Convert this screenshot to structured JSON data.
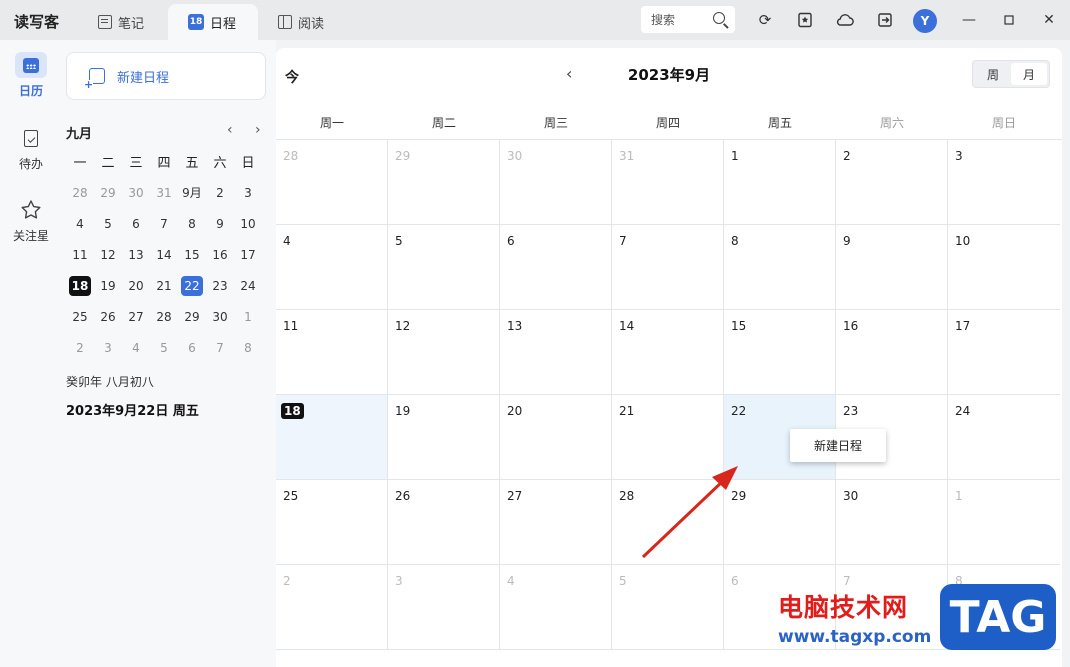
{
  "app": {
    "name": "读写客"
  },
  "tabs": [
    {
      "label": "笔记",
      "icon": "notes-icon"
    },
    {
      "label": "日程",
      "icon": "calendar-icon",
      "badge": "18",
      "active": true
    },
    {
      "label": "阅读",
      "icon": "reader-icon"
    }
  ],
  "toolbar": {
    "search_label": "搜索",
    "avatar_initial": "Y"
  },
  "rail": [
    {
      "label": "日历",
      "icon": "calendar-icon",
      "active": true
    },
    {
      "label": "待办",
      "icon": "clipboard-check-icon"
    },
    {
      "label": "关注星",
      "icon": "star-icon"
    }
  ],
  "side": {
    "new_event_label": "新建日程",
    "mini_month": "九月",
    "weekdays": [
      "一",
      "二",
      "三",
      "四",
      "五",
      "六",
      "日"
    ],
    "rows": [
      [
        "28",
        "29",
        "30",
        "31",
        "9月",
        "2",
        "3"
      ],
      [
        "4",
        "5",
        "6",
        "7",
        "8",
        "9",
        "10"
      ],
      [
        "11",
        "12",
        "13",
        "14",
        "15",
        "16",
        "17"
      ],
      [
        "18",
        "19",
        "20",
        "21",
        "22",
        "23",
        "24"
      ],
      [
        "25",
        "26",
        "27",
        "28",
        "29",
        "30",
        "1"
      ],
      [
        "2",
        "3",
        "4",
        "5",
        "6",
        "7",
        "8"
      ]
    ],
    "lunar": "癸卯年  八月初八",
    "selected_date": "2023年9月22日  周五"
  },
  "calendar": {
    "today_label": "今",
    "month_title": "2023年9月",
    "view_week": "周",
    "view_month": "月",
    "weekdays": [
      "周一",
      "周二",
      "周三",
      "周四",
      "周五",
      "周六",
      "周日"
    ],
    "weeks": [
      [
        "28",
        "29",
        "30",
        "31",
        "1",
        "2",
        "3"
      ],
      [
        "4",
        "5",
        "6",
        "7",
        "8",
        "9",
        "10"
      ],
      [
        "11",
        "12",
        "13",
        "14",
        "15",
        "16",
        "17"
      ],
      [
        "18",
        "19",
        "20",
        "21",
        "22",
        "23",
        "24"
      ],
      [
        "25",
        "26",
        "27",
        "28",
        "29",
        "30",
        "1"
      ],
      [
        "2",
        "3",
        "4",
        "5",
        "6",
        "7",
        "8"
      ]
    ],
    "context_menu": "新建日程"
  },
  "watermark": {
    "text": "电脑技术网",
    "url": "www.tagxp.com",
    "logo": "TAG"
  }
}
